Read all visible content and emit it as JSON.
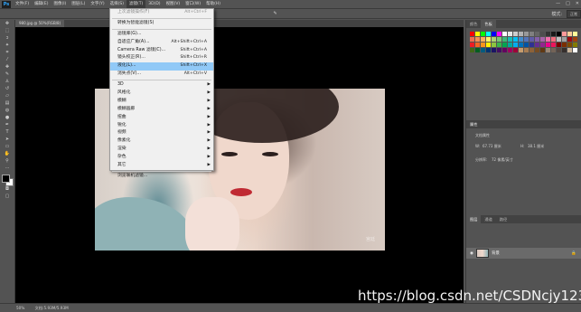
{
  "app": {
    "logo": "Ps"
  },
  "menubar": {
    "items": [
      "文件(F)",
      "编辑(E)",
      "图像(I)",
      "图层(L)",
      "文字(Y)",
      "选择(S)",
      "滤镜(T)",
      "3D(D)",
      "视图(V)",
      "窗口(W)",
      "帮助(H)"
    ],
    "window_controls": [
      "—",
      "□",
      "✕"
    ]
  },
  "options": {
    "mode_label": "模式:",
    "mode_value": "正常"
  },
  "document": {
    "tab_title": "980.jpg @ 50%(RGB/8)"
  },
  "filter_menu": {
    "items": [
      {
        "label": "上次滤镜操作(F)",
        "shortcut": "Alt+Ctrl+F",
        "disabled": true
      },
      {
        "sep": true
      },
      {
        "label": "转换为智能滤镜(S)"
      },
      {
        "sep": true
      },
      {
        "label": "滤镜库(G)..."
      },
      {
        "label": "自适应广角(A)...",
        "shortcut": "Alt+Shift+Ctrl+A"
      },
      {
        "label": "Camera Raw 滤镜(C)...",
        "shortcut": "Shift+Ctrl+A"
      },
      {
        "label": "镜头校正(R)...",
        "shortcut": "Shift+Ctrl+R"
      },
      {
        "label": "液化(L)...",
        "shortcut": "Shift+Ctrl+X",
        "highlighted": true
      },
      {
        "label": "消失点(V)...",
        "shortcut": "Alt+Ctrl+V"
      },
      {
        "sep": true
      },
      {
        "label": "3D",
        "submenu": true
      },
      {
        "label": "风格化",
        "submenu": true
      },
      {
        "label": "模糊",
        "submenu": true
      },
      {
        "label": "模糊画廊",
        "submenu": true
      },
      {
        "label": "扭曲",
        "submenu": true
      },
      {
        "label": "锐化",
        "submenu": true
      },
      {
        "label": "视频",
        "submenu": true
      },
      {
        "label": "像素化",
        "submenu": true
      },
      {
        "label": "渲染",
        "submenu": true
      },
      {
        "label": "杂色",
        "submenu": true
      },
      {
        "label": "其它",
        "submenu": true
      },
      {
        "sep": true
      },
      {
        "label": "浏览联机滤镜..."
      }
    ]
  },
  "panels": {
    "color_tabs": [
      "颜色",
      "色板"
    ],
    "swatch_colors": [
      "#ff0000",
      "#ffff00",
      "#00ff00",
      "#00ffff",
      "#0000ff",
      "#ff00ff",
      "#ffffff",
      "#e6e6e6",
      "#cccccc",
      "#b3b3b3",
      "#999999",
      "#808080",
      "#666666",
      "#4d4d4d",
      "#333333",
      "#1a1a1a",
      "#000000",
      "#ff9999",
      "#ffcc99",
      "#ffff99",
      "#f26c4f",
      "#f68e55",
      "#fbaf5c",
      "#fff467",
      "#acd372",
      "#7cc576",
      "#3bb878",
      "#1abbb4",
      "#00bff3",
      "#438ccb",
      "#5574b9",
      "#605ca8",
      "#855fa8",
      "#a763a8",
      "#f06ea9",
      "#f26d7d",
      "#c0c0c0",
      "#a0a0a0",
      "#9e0b0f",
      "#a0410d",
      "#ed1c24",
      "#f26522",
      "#f7941d",
      "#fff200",
      "#8dc63f",
      "#39b54a",
      "#00a651",
      "#00a99d",
      "#00aeef",
      "#0072bc",
      "#0054a6",
      "#2e3192",
      "#662d91",
      "#92278f",
      "#ec008c",
      "#ed145b",
      "#790000",
      "#7b2e00",
      "#7d4900",
      "#827b00",
      "#406618",
      "#005e20",
      "#005b7f",
      "#003471",
      "#1b1464",
      "#440e62",
      "#630460",
      "#9e005d",
      "#9e0039",
      "#c69c6d",
      "#a67c52",
      "#8c6239",
      "#754c24",
      "#603913",
      "#998675",
      "#736357",
      "#534741",
      "#362f2d",
      "#c7b299",
      "#ffffff"
    ],
    "properties_title": "属性",
    "properties_subtitle": "文档属性",
    "prop_w_label": "W:",
    "prop_w_value": "67.73 厘米",
    "prop_h_label": "H:",
    "prop_h_value": "38.1 厘米",
    "prop_res_label": "分辨率:",
    "prop_res_value": "72 像素/英寸",
    "layers_tabs": [
      "图层",
      "通道",
      "路径"
    ],
    "layer_name": "背景"
  },
  "status": {
    "zoom": "50%",
    "doc_info": "文档:5.93M/5.93M"
  },
  "photo_watermark": "宫廷",
  "page_watermark": "https://blog.csdn.net/CSDNcjy123"
}
